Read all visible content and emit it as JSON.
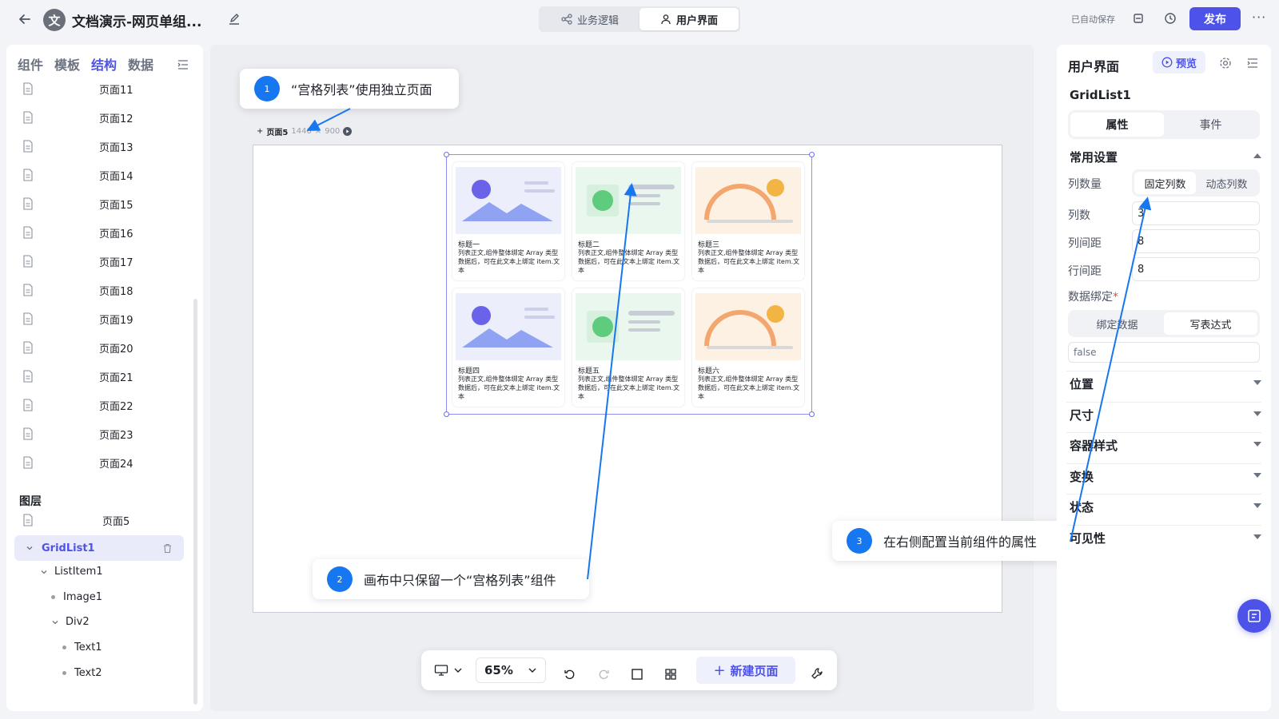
{
  "header": {
    "app_logo_char": "文",
    "title": "文档演示-网页单组...",
    "tabs": [
      {
        "label": "业务逻辑",
        "active": false
      },
      {
        "label": "用户界面",
        "active": true
      }
    ],
    "autosave": "已自动保存",
    "publish_label": "发布"
  },
  "left_panel": {
    "tabs": [
      {
        "label": "组件"
      },
      {
        "label": "模板"
      },
      {
        "label": "结构",
        "active": true
      },
      {
        "label": "数据"
      }
    ],
    "pages": [
      "页面11",
      "页面12",
      "页面13",
      "页面14",
      "页面15",
      "页面16",
      "页面17",
      "页面18",
      "页面19",
      "页面20",
      "页面21",
      "页面22",
      "页面23",
      "页面24"
    ],
    "layer_title": "图层",
    "layer_page": "页面5",
    "tree": {
      "selected": "GridList1",
      "list_item": "ListItem1",
      "image": "Image1",
      "div": "Div2",
      "text1": "Text1",
      "text2": "Text2"
    }
  },
  "canvas": {
    "frame_label": "页面5",
    "frame_width": "1440",
    "frame_sep": "×",
    "frame_height": "900",
    "cards": [
      {
        "title": "标题一",
        "body": "列表正文,组件整体绑定 Array 类型数据后，可在此文本上绑定 item.文本",
        "style": "purple"
      },
      {
        "title": "标题二",
        "body": "列表正文,组件整体绑定 Array 类型数据后，可在此文本上绑定 item.文本",
        "style": "green"
      },
      {
        "title": "标题三",
        "body": "列表正文,组件整体绑定 Array 类型数据后，可在此文本上绑定 item.文本",
        "style": "orange"
      },
      {
        "title": "标题四",
        "body": "列表正文,组件整体绑定 Array 类型数据后，可在此文本上绑定 item.文本",
        "style": "purple"
      },
      {
        "title": "标题五",
        "body": "列表正文,组件整体绑定 Array 类型数据后，可在此文本上绑定 item.文本",
        "style": "green"
      },
      {
        "title": "标题六",
        "body": "列表正文,组件整体绑定 Array 类型数据后，可在此文本上绑定 item.文本",
        "style": "orange"
      }
    ]
  },
  "callouts": [
    {
      "num": "1",
      "text": "“宫格列表”使用独立页面"
    },
    {
      "num": "2",
      "text": "画布中只保留一个“宫格列表”组件"
    },
    {
      "num": "3",
      "text": "在右侧配置当前组件的属性"
    }
  ],
  "toolbar": {
    "zoom": "65%",
    "new_page": "新建页面"
  },
  "right_panel": {
    "title": "用户界面",
    "preview_label": "预览",
    "component_name": "GridList1",
    "tabs": [
      {
        "label": "属性",
        "active": true
      },
      {
        "label": "事件",
        "active": false
      }
    ],
    "common_settings": "常用设置",
    "column_mode_label": "列数量",
    "column_modes": [
      {
        "label": "固定列数",
        "active": true
      },
      {
        "label": "动态列数",
        "active": false
      }
    ],
    "columns_label": "列数",
    "columns_value": "3",
    "col_gap_label": "列间距",
    "col_gap_value": "8",
    "row_gap_label": "行间距",
    "row_gap_value": "8",
    "binding_label": "数据绑定",
    "binding_required": "*",
    "binding_modes": [
      {
        "label": "绑定数据",
        "active": false
      },
      {
        "label": "写表达式",
        "active": true
      }
    ],
    "expression_value": "false",
    "sections": [
      "位置",
      "尺寸",
      "容器样式",
      "变换",
      "状态",
      "可见性"
    ]
  },
  "colors": {
    "accent": "#4d53e8",
    "callout": "#1677f0"
  }
}
